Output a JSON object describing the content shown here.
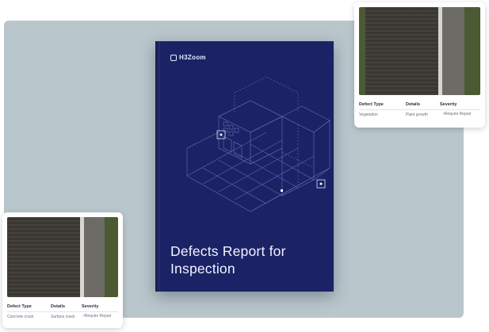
{
  "book": {
    "logo_text": "H3Zoom",
    "title": "Defects Report for Inspection",
    "cover_color": "#1b2366",
    "line_color": "#5c66a8"
  },
  "card_top": {
    "columns": [
      "Defect Type",
      "Details",
      "Severity"
    ],
    "row": {
      "defect_type": "Vegetation",
      "details": "Plant growth",
      "severity": "Require Repair"
    }
  },
  "card_bottom": {
    "columns": [
      "Defect Type",
      "Details",
      "Severity"
    ],
    "row": {
      "defect_type": "Concrete crack",
      "details": "Surface crack",
      "severity": "Require Repair"
    }
  }
}
